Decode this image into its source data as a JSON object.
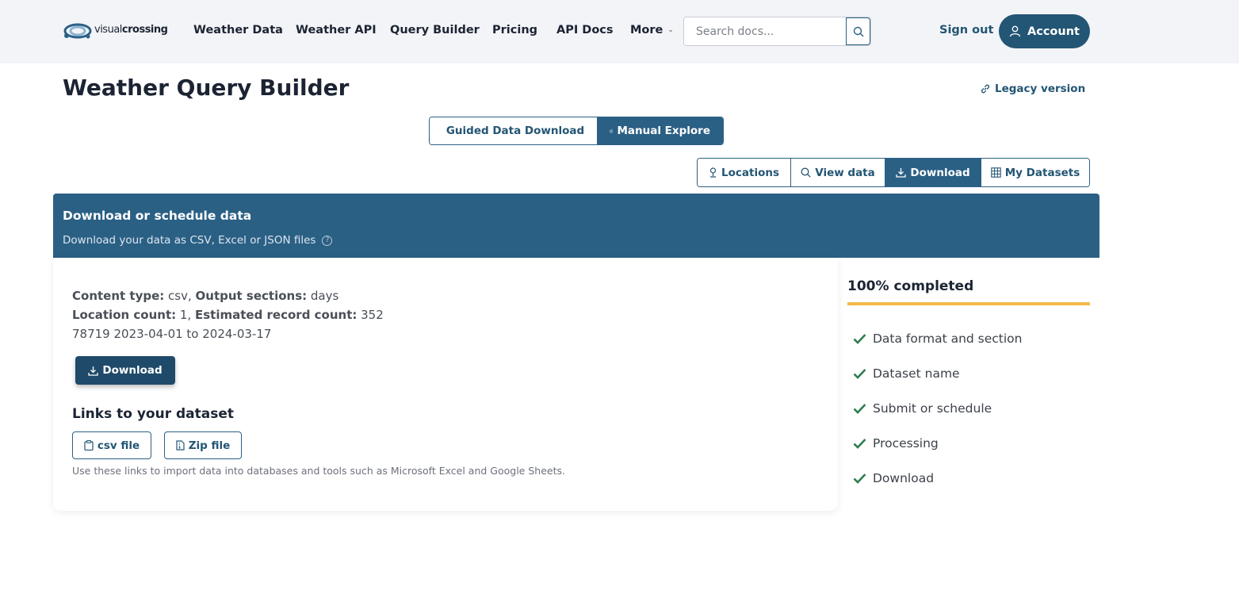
{
  "header": {
    "logo_text_light": "visual",
    "logo_text_bold": "crossing",
    "nav": [
      "Weather Data",
      "Weather API",
      "Query Builder",
      "Pricing",
      "API Docs"
    ],
    "more_label": "More",
    "search_placeholder": "Search docs...",
    "sign_out": "Sign out",
    "account": "Account"
  },
  "page": {
    "title": "Weather Query Builder",
    "legacy_link": "Legacy version"
  },
  "mode_toggle": {
    "guided": "Guided Data Download",
    "manual": "Manual Explore",
    "active": "manual"
  },
  "step_tabs": {
    "items": [
      "Locations",
      "View data",
      "Download",
      "My Datasets"
    ],
    "active": "Download"
  },
  "panel": {
    "title": "Download or schedule data",
    "subtitle": "Download your data as CSV, Excel or JSON files",
    "help_glyph": "?"
  },
  "summary": {
    "content_type_label": "Content type:",
    "content_type_value": " csv, ",
    "output_sections_label": "Output sections:",
    "output_sections_value": " days",
    "location_count_label": "Location count:",
    "location_count_value": " 1, ",
    "record_count_label": "Estimated record count:",
    "record_count_value": " 352",
    "location_range": "78719 2023-04-01 to 2024-03-17",
    "download_button": "Download"
  },
  "links": {
    "title": "Links to your dataset",
    "csv_button": "csv file",
    "zip_button": "Zip file",
    "note": "Use these links to import data into databases and tools such as Microsoft Excel and Google Sheets."
  },
  "progress": {
    "title": "100% completed",
    "percent": 100,
    "bar_color": "#f2b94a",
    "check_color": "#2e7d4f",
    "steps": [
      "Data format and section",
      "Dataset name",
      "Submit or schedule",
      "Processing",
      "Download"
    ]
  },
  "colors": {
    "primary": "#2b6085",
    "primary_dark": "#1f4a6a",
    "nav_bg": "#f3f4f8"
  }
}
